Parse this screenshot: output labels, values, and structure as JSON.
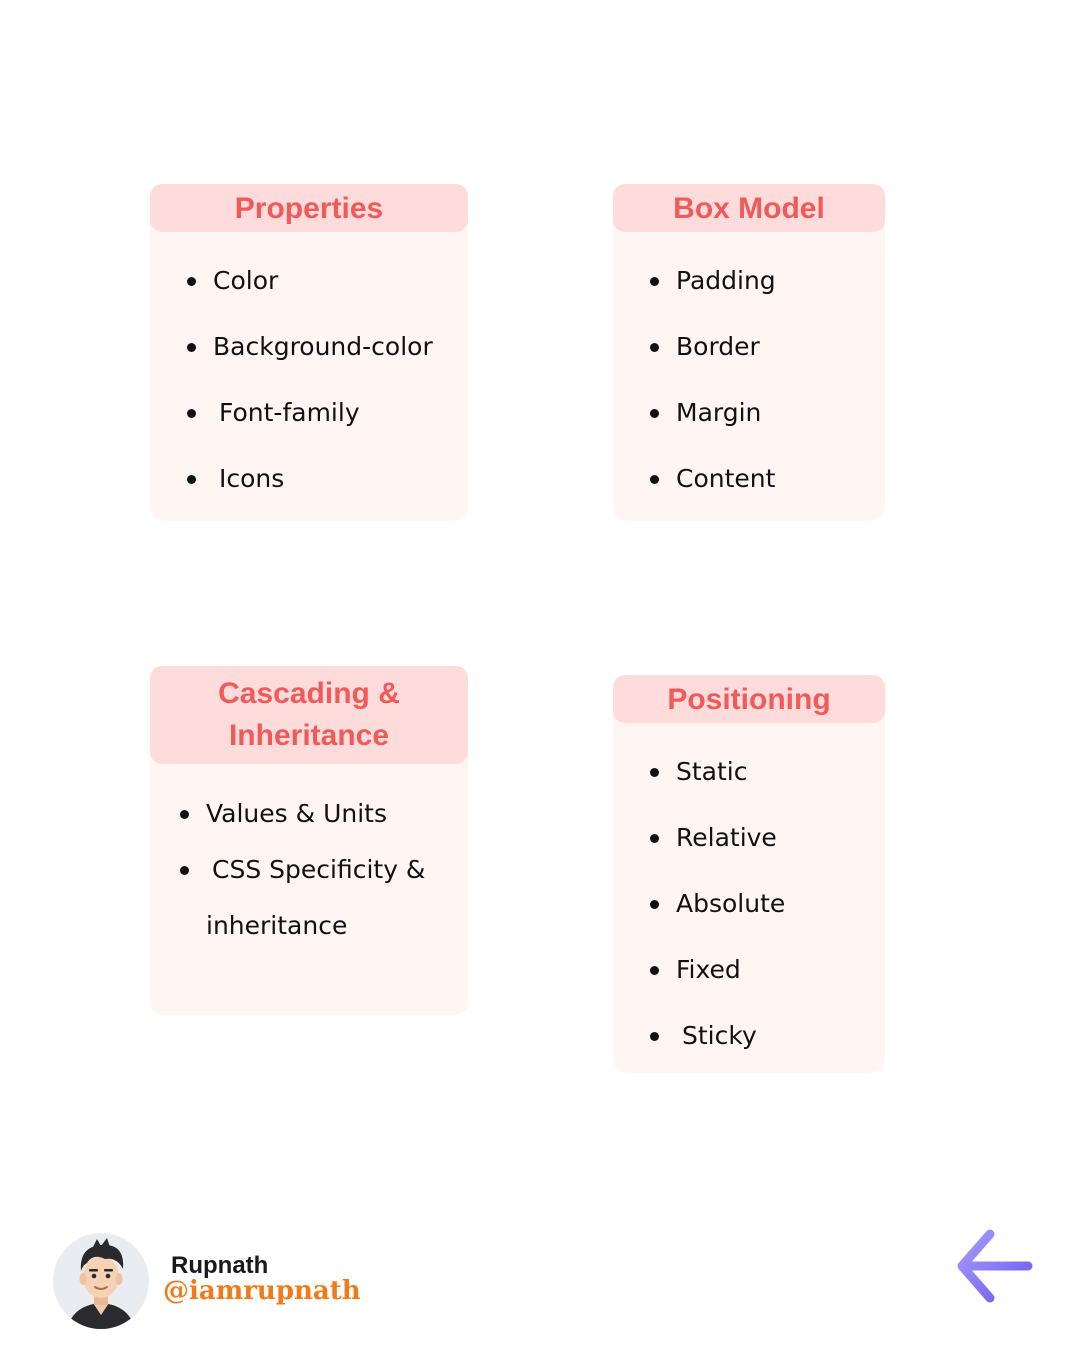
{
  "cards": {
    "properties": {
      "title": "Properties",
      "items": [
        "Color",
        "Background-color",
        "Font-family",
        "Icons"
      ]
    },
    "box_model": {
      "title": "Box Model",
      "items": [
        "Padding",
        "Border",
        "Margin",
        "Content"
      ]
    },
    "cascading": {
      "title_line1": "Cascading &",
      "title_line2": "Inheritance",
      "items": [
        "Values & Units",
        "CSS Specificity &",
        "inheritance"
      ]
    },
    "positioning": {
      "title": "Positioning",
      "items": [
        "Static",
        "Relative",
        "Absolute",
        "Fixed",
        "Sticky"
      ]
    }
  },
  "footer": {
    "name": "Rupnath",
    "handle": "@iamrupnath",
    "avatar_icon": "avatar-icon",
    "nav_icon": "arrow-left-icon"
  },
  "colors": {
    "header_text": "#f05a5a",
    "header_bg": "#ffdcdc",
    "card_bg": "#fff6f4",
    "handle": "#f27a1a",
    "arrow": "#8b7cf6"
  }
}
